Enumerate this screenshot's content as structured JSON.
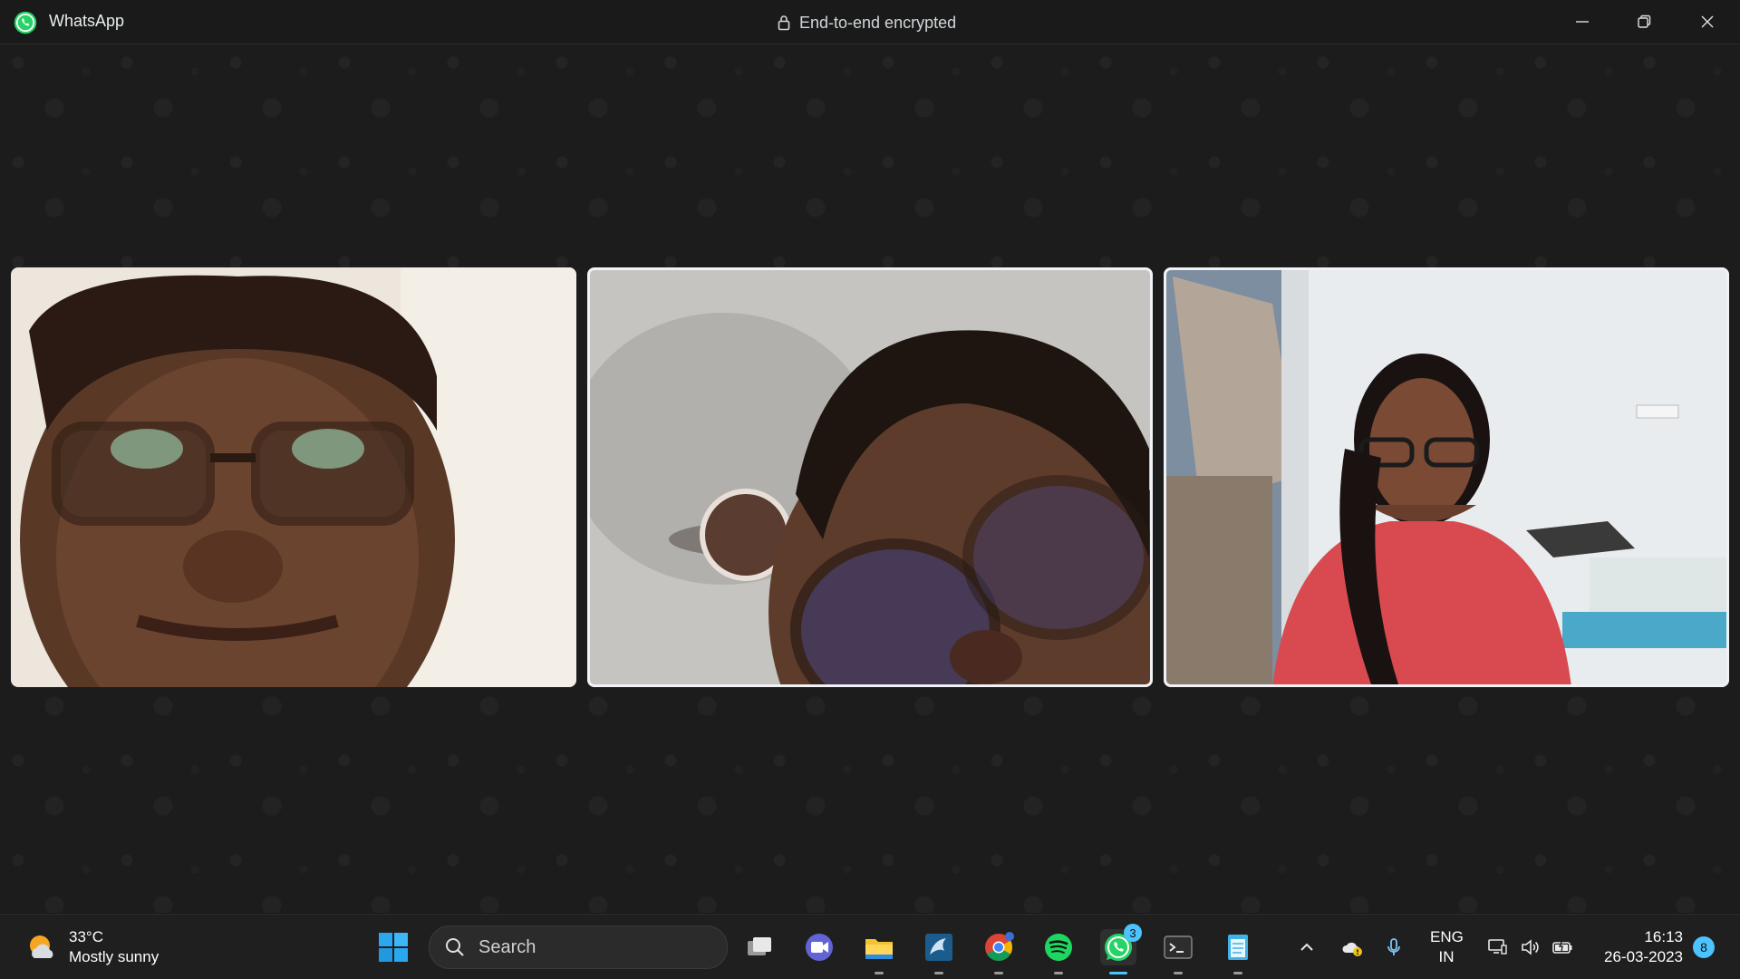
{
  "window": {
    "app_name": "WhatsApp",
    "encryption_label": "End-to-end encrypted",
    "brand_color": "#25d366"
  },
  "call": {
    "participants": [
      {
        "video": "participant-1-video",
        "active": false
      },
      {
        "video": "participant-2-video",
        "active": true
      },
      {
        "video": "participant-3-video",
        "active": true
      }
    ]
  },
  "taskbar": {
    "weather": {
      "temperature": "33°C",
      "condition": "Mostly sunny",
      "icon": "sun-cloud-icon"
    },
    "search_label": "Search",
    "pinned_apps": [
      {
        "name": "start-button",
        "icon": "windows-logo-icon"
      },
      {
        "name": "task-view",
        "icon": "task-view-icon"
      },
      {
        "name": "teams-chat",
        "icon": "teams-icon"
      },
      {
        "name": "file-explorer",
        "icon": "folder-icon"
      },
      {
        "name": "mysql-workbench",
        "icon": "dolphin-icon"
      },
      {
        "name": "chrome",
        "icon": "chrome-icon"
      },
      {
        "name": "spotify",
        "icon": "spotify-icon"
      },
      {
        "name": "whatsapp",
        "icon": "whatsapp-icon",
        "badge": "3"
      },
      {
        "name": "terminal",
        "icon": "terminal-icon"
      },
      {
        "name": "notepad",
        "icon": "notepad-icon"
      }
    ],
    "tray": {
      "language_top": "ENG",
      "language_bottom": "IN",
      "time": "16:13",
      "date": "26-03-2023",
      "notifications": "8"
    },
    "accent": "#4cc2ff"
  }
}
